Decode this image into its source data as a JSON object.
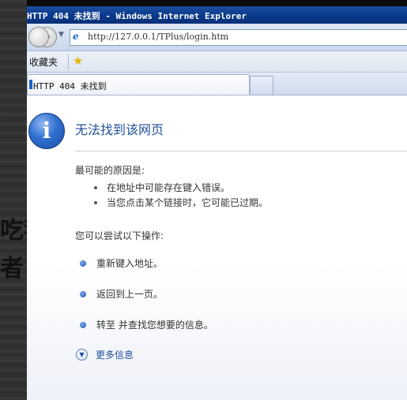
{
  "background": {
    "text_line1": "吃我",
    "text_line2": "者"
  },
  "window": {
    "title": "HTTP 404 未找到 - Windows Internet Explorer"
  },
  "navbar": {
    "address_url": "http://127.0.0.1/TPlus/login.htm"
  },
  "favorites_bar": {
    "label": "收藏夹"
  },
  "tabs": [
    {
      "label": "HTTP 404 未找到"
    }
  ],
  "page": {
    "title": "无法找到该网页",
    "cause_heading": "最可能的原因是:",
    "causes": [
      "在地址中可能存在键入错误。",
      "当您点击某个链接时，它可能已过期。"
    ],
    "try_heading": "您可以尝试以下操作:",
    "actions": [
      "重新键入地址。",
      "返回到上一页。",
      "转至  并查找您想要的信息。"
    ],
    "more_info": "更多信息"
  },
  "colors": {
    "title_bar": "#0a3a8c",
    "page_title": "#1f4f96",
    "link": "#1f4fa0"
  },
  "icons": [
    "back-icon",
    "forward-icon",
    "ie-page-icon",
    "favorites-star-icon",
    "info-icon",
    "bullet-icon",
    "expand-chevron-icon"
  ]
}
